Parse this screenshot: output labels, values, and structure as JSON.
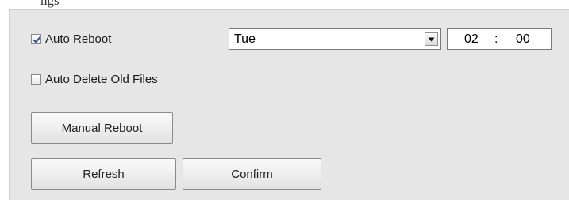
{
  "header": {
    "partial_text": "ngs"
  },
  "auto_reboot": {
    "label": "Auto Reboot",
    "checked": true,
    "day_value": "Tue",
    "hour": "02",
    "separator": ":",
    "minute": "00"
  },
  "auto_delete": {
    "label": "Auto Delete Old Files",
    "checked": false
  },
  "buttons": {
    "manual_reboot": "Manual Reboot",
    "refresh": "Refresh",
    "confirm": "Confirm"
  },
  "icons": {
    "select_arrow": "chevron-down-icon",
    "check": "check-icon"
  },
  "colors": {
    "panel_bg": "#e6e6e6",
    "check_mark": "#2a4f9e"
  }
}
